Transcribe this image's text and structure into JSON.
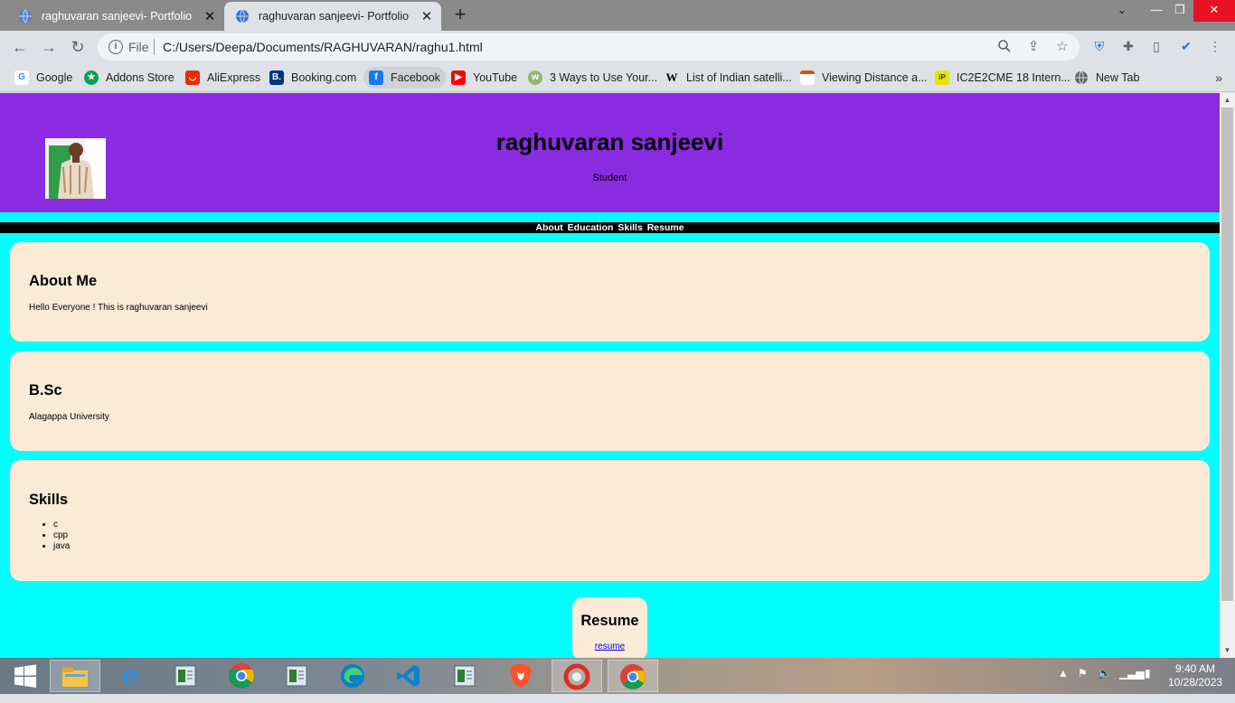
{
  "browser": {
    "tabs": [
      {
        "title": "raghuvaran sanjeevi- Portfolio",
        "active": false,
        "favicon": "globe-icon"
      },
      {
        "title": "raghuvaran sanjeevi- Portfolio",
        "active": true,
        "favicon": "globe-icon"
      }
    ],
    "address": {
      "scheme_label": "File",
      "url": "C:/Users/Deepa/Documents/RAGHUVARAN/raghu1.html"
    },
    "bookmarks": [
      {
        "label": "Google",
        "icon": "google-icon"
      },
      {
        "label": "Addons Store",
        "icon": "addons-store-icon"
      },
      {
        "label": "AliExpress",
        "icon": "aliexpress-icon"
      },
      {
        "label": "Booking.com",
        "icon": "booking-icon"
      },
      {
        "label": "Facebook",
        "icon": "facebook-icon"
      },
      {
        "label": "YouTube",
        "icon": "youtube-icon"
      },
      {
        "label": "3 Ways to Use Your...",
        "icon": "wikihow-icon"
      },
      {
        "label": "List of Indian satelli...",
        "icon": "wikipedia-icon"
      },
      {
        "label": "Viewing Distance a...",
        "icon": "page-icon"
      },
      {
        "label": "IC2E2CME 18 Intern...",
        "icon": "ic2e2cme-icon"
      },
      {
        "label": "New Tab",
        "icon": "globe-icon"
      }
    ]
  },
  "page": {
    "header": {
      "title": "raghuvaran sanjeevi",
      "subtitle": "Student"
    },
    "nav": [
      "About",
      "Education",
      "Skills",
      "Resume"
    ],
    "about": {
      "heading": "About Me",
      "text": "Hello Everyone ! This is raghuvaran sanjeevi"
    },
    "education": {
      "heading": "B.Sc",
      "text": "Alagappa University"
    },
    "skills": {
      "heading": "Skills",
      "items": [
        "c",
        "cpp",
        "java"
      ]
    },
    "resume": {
      "heading": "Resume",
      "link": "resume"
    }
  },
  "taskbar": {
    "apps": [
      "windows-start-icon",
      "file-explorer-icon",
      "internet-explorer-icon",
      "notepad-icon",
      "chrome-icon",
      "notepad-icon",
      "edge-icon",
      "vscode-icon",
      "notepad-icon",
      "brave-icon",
      "app-icon",
      "chrome-icon"
    ],
    "clock": {
      "time": "9:40 AM",
      "date": "10/28/2023"
    }
  },
  "colors": {
    "header_bg": "#8a2be2",
    "page_bg": "#00ffff",
    "card_bg": "#faebd7",
    "nav_bg": "#000000"
  }
}
